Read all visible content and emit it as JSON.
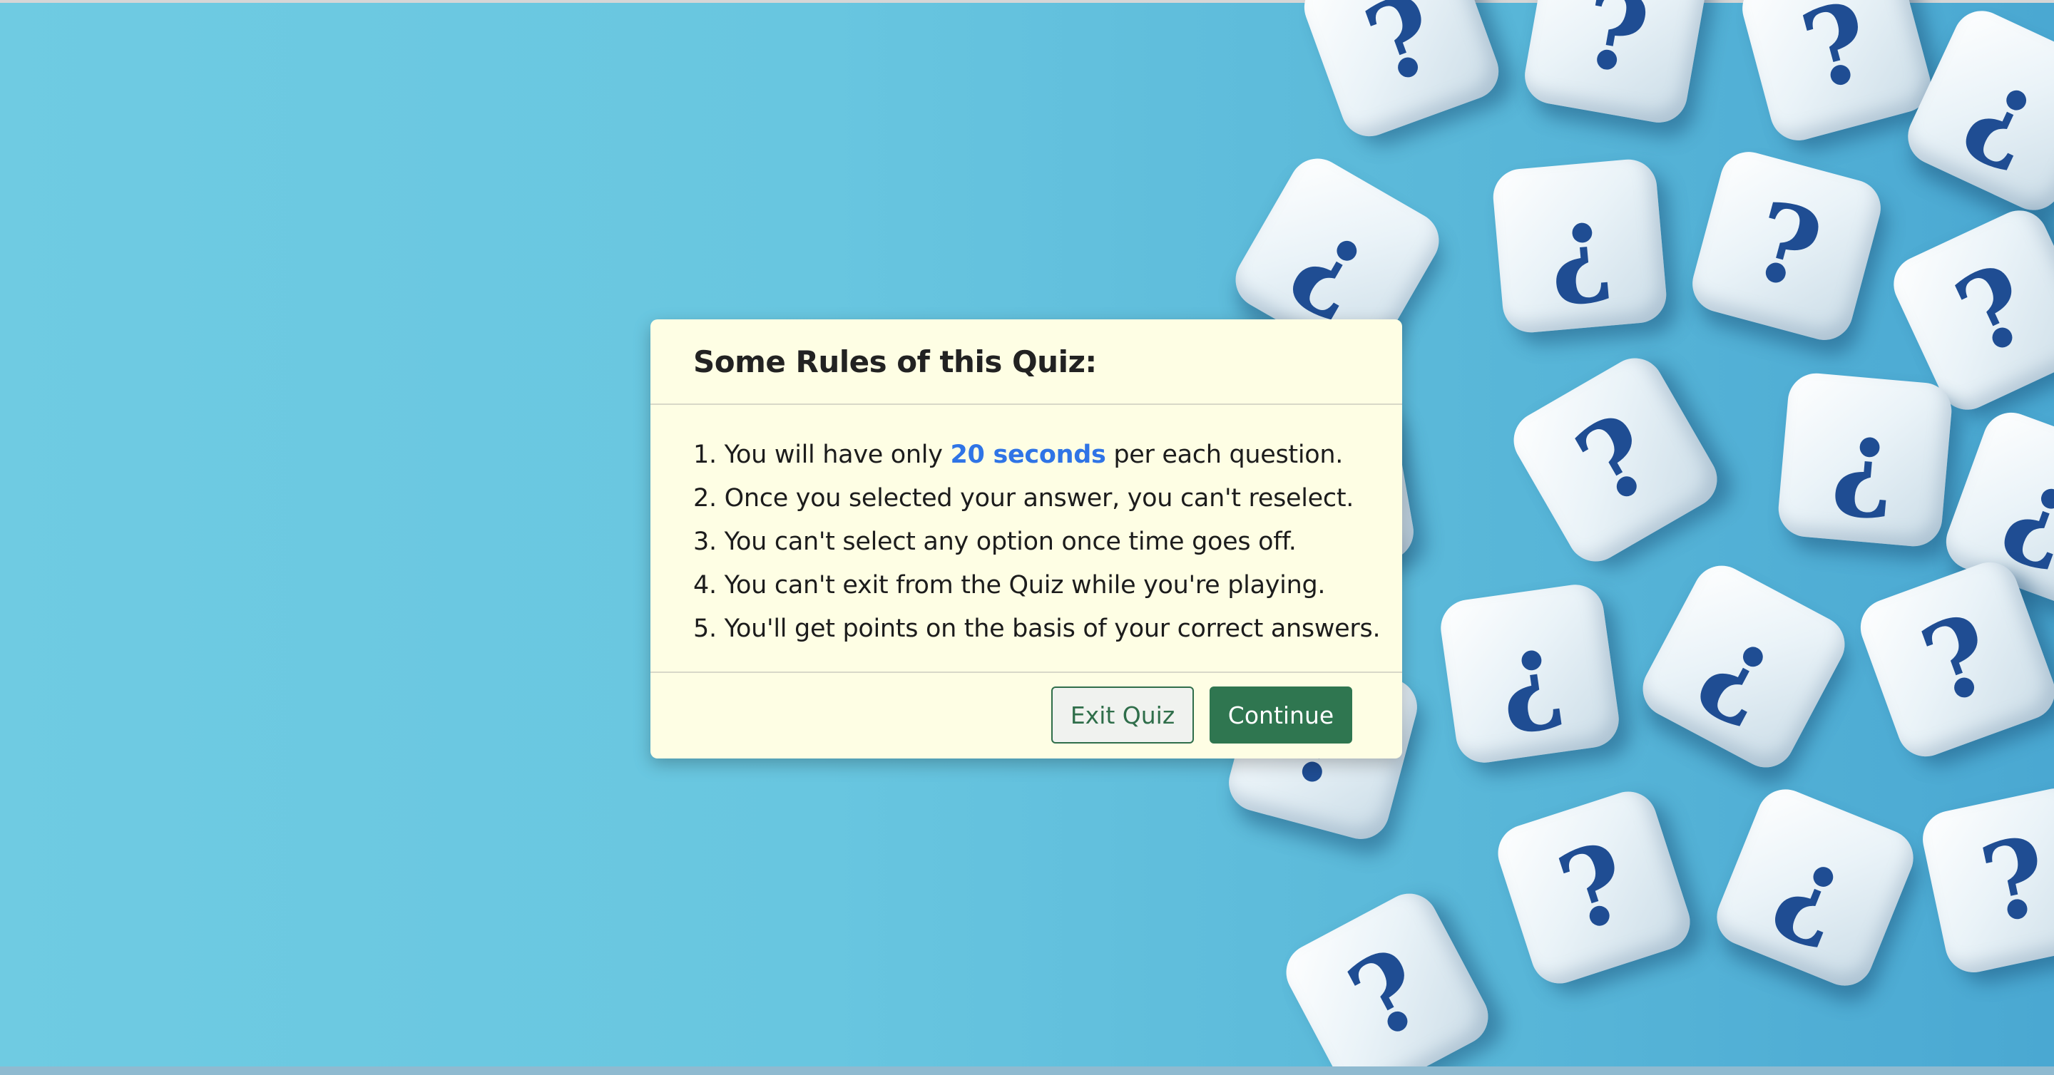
{
  "background": {
    "color": "#6fcbe2",
    "image": "dice-with-question-marks"
  },
  "modal": {
    "title": "Some Rules of this Quiz:",
    "rules": [
      {
        "prefix": "1. You will have only ",
        "highlight": "20 seconds",
        "suffix": " per each question."
      },
      {
        "text": "2. Once you selected your answer, you can't reselect."
      },
      {
        "text": "3. You can't select any option once time goes off."
      },
      {
        "text": "4. You can't exit from the Quiz while you're playing."
      },
      {
        "text": "5. You'll get points on the basis of your correct answers."
      }
    ],
    "exit_label": "Exit Quiz",
    "continue_label": "Continue",
    "colors": {
      "background": "#fefee4",
      "highlight": "#2f74e6",
      "primary": "#2f7650"
    }
  }
}
